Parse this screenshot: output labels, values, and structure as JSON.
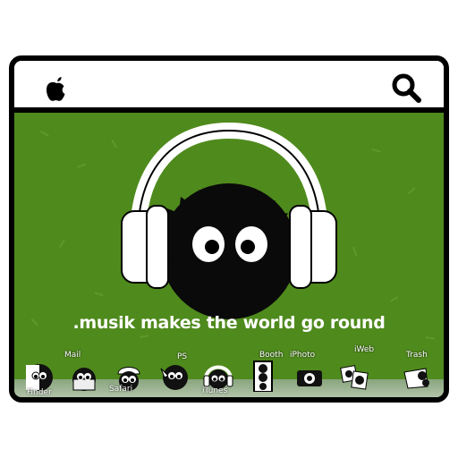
{
  "menubar": {
    "left_icon": "apple-logo-icon",
    "right_icon": "search-icon"
  },
  "wallpaper": {
    "tagline": ".musik makes the world go round",
    "background_color": "#4f8a1d"
  },
  "dock": {
    "items": [
      {
        "label": "Finder"
      },
      {
        "label": "Mail"
      },
      {
        "label": "Safari"
      },
      {
        "label": "PS"
      },
      {
        "label": "iTunes"
      },
      {
        "label": "Booth"
      },
      {
        "label": "iPhoto"
      },
      {
        "label": "iWeb"
      },
      {
        "label": "Trash"
      }
    ]
  }
}
